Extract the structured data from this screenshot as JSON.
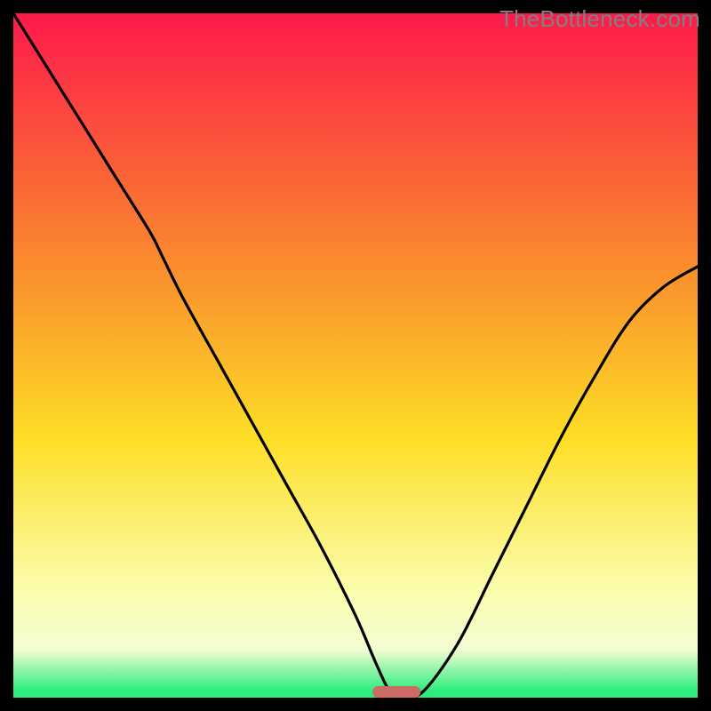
{
  "watermark": "TheBottleneck.com",
  "colors": {
    "background": "#000000",
    "gradient_top": "#fe194b",
    "gradient_mid_upper": "#f97d30",
    "gradient_mid": "#fede26",
    "gradient_lower": "#fbfdab",
    "gradient_band": "#f4fdd3",
    "gradient_green": "#2ced7e",
    "curve": "#000000",
    "marker": "#cc6b66"
  },
  "chart_data": {
    "type": "line",
    "title": "",
    "xlabel": "",
    "ylabel": "",
    "xlim": [
      0,
      100
    ],
    "ylim": [
      0,
      100
    ],
    "series": [
      {
        "name": "bottleneck-curve",
        "x": [
          0,
          5,
          10,
          15,
          20,
          22,
          25,
          30,
          35,
          40,
          45,
          50,
          53,
          55,
          57,
          60,
          65,
          70,
          75,
          80,
          85,
          90,
          95,
          100
        ],
        "values": [
          100,
          92,
          84,
          76,
          68,
          64,
          58,
          49,
          40,
          31,
          22,
          12,
          5,
          1,
          0,
          1,
          8,
          18,
          28,
          38,
          47,
          55,
          60,
          63
        ]
      }
    ],
    "marker": {
      "name": "optimal-zone",
      "x_center": 56,
      "width": 7,
      "y": 0
    },
    "annotations": []
  }
}
